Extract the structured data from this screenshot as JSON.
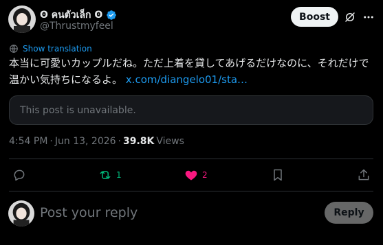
{
  "author": {
    "display_name": "ʘ คนตัวเล็ก ʘ",
    "handle": "@Thrustmyfeel",
    "verified": true
  },
  "header": {
    "boost_label": "Boost",
    "grok_icon": "grok-icon",
    "more_icon": "more-icon"
  },
  "translation": {
    "label": "Show translation"
  },
  "post": {
    "text": "本当に可愛いカップルだね。ただ上着を貸してあげるだけなのに、それだけで温かい気持ちになるよ。",
    "link": "x.com/diangelo01/sta…"
  },
  "quote": {
    "unavailable_text": "This post is unavailable."
  },
  "meta": {
    "time": "4:54 PM",
    "date": "Jun 13, 2026",
    "separator": "·",
    "views_count": "39.8K",
    "views_label": "Views"
  },
  "actions": {
    "reposts": "1",
    "likes": "2"
  },
  "reply": {
    "placeholder": "Post your reply",
    "button_label": "Reply"
  },
  "colors": {
    "background": "#000000",
    "text": "#e7e9ea",
    "muted": "#71767b",
    "accent": "#1d9bf0",
    "repost_green": "#00ba7c",
    "like_pink": "#f91880",
    "border": "#2f3336"
  }
}
